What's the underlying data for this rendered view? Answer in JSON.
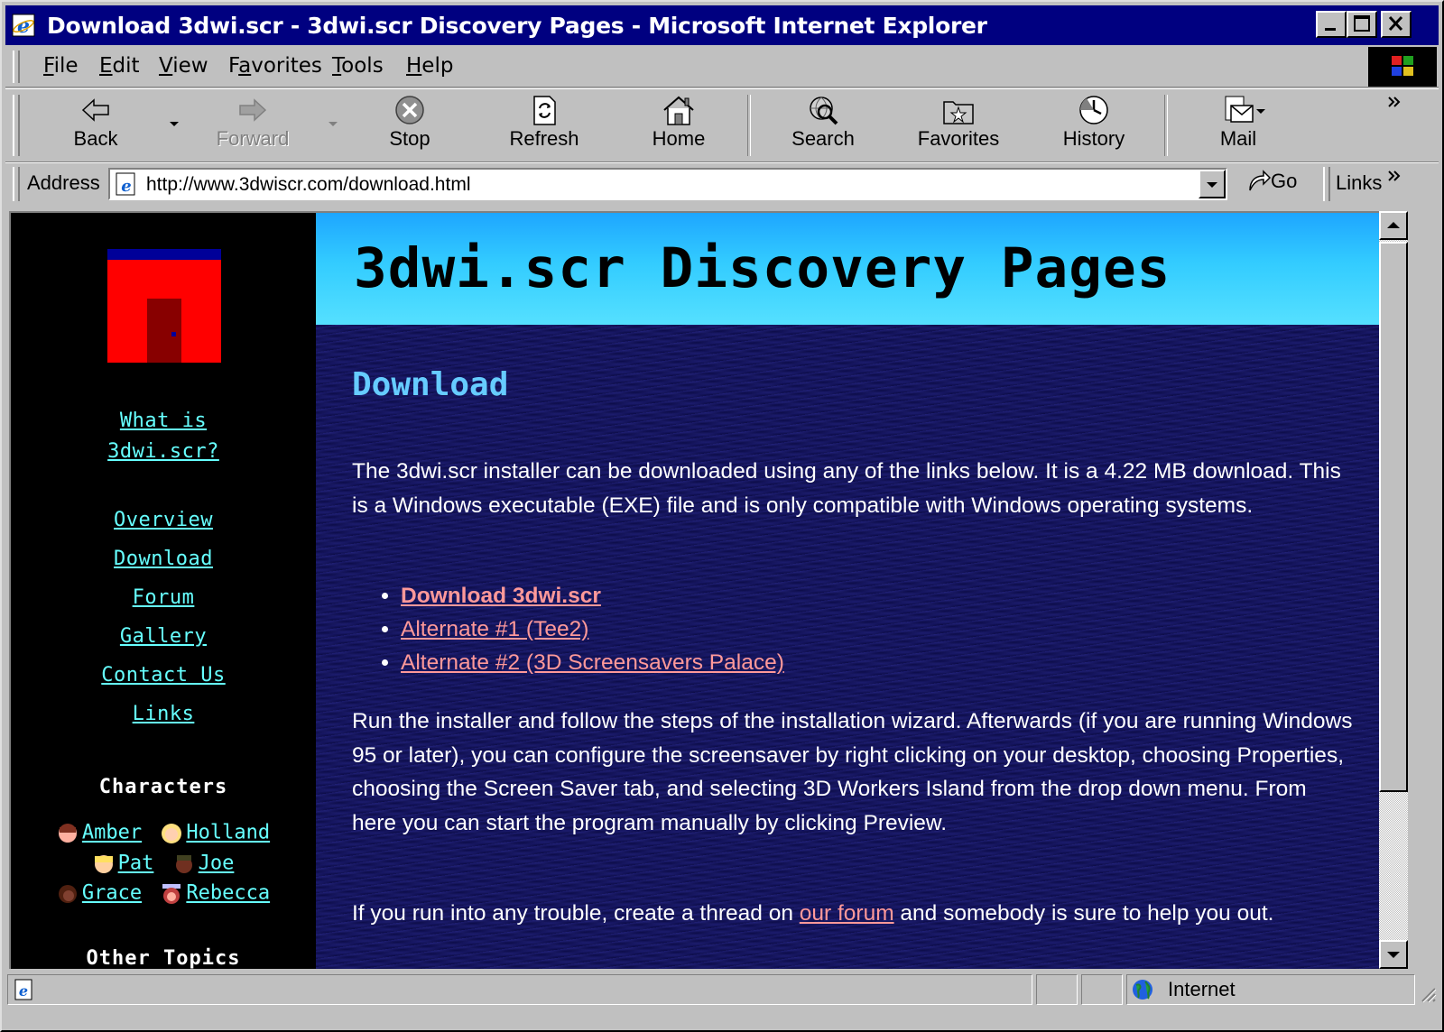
{
  "window": {
    "title": "Download 3dwi.scr - 3dwi.scr Discovery Pages - Microsoft Internet Explorer"
  },
  "menu": {
    "items": [
      {
        "label": "File",
        "accel": "F",
        "rest": "ile"
      },
      {
        "label": "Edit",
        "accel": "E",
        "rest": "dit"
      },
      {
        "label": "View",
        "accel": "V",
        "rest": "iew"
      },
      {
        "label": "Favorites",
        "pre": "F",
        "accel": "a",
        "rest": "vorites"
      },
      {
        "label": "Tools",
        "accel": "T",
        "rest": "ools"
      },
      {
        "label": "Help",
        "accel": "H",
        "rest": "elp"
      }
    ]
  },
  "toolbar": {
    "back": "Back",
    "forward": "Forward",
    "stop": "Stop",
    "refresh": "Refresh",
    "home": "Home",
    "search": "Search",
    "favorites": "Favorites",
    "history": "History",
    "mail": "Mail"
  },
  "address": {
    "label": "Address",
    "url": "http://www.3dwiscr.com/download.html",
    "go": "Go",
    "links": "Links"
  },
  "sidebar": {
    "what_is_1": "What is",
    "what_is_2": "3dwi.scr?",
    "nav": [
      "Overview",
      "Download",
      "Forum",
      "Gallery",
      "Contact Us",
      "Links"
    ],
    "characters_heading": "Characters",
    "characters": [
      "Amber",
      "Holland",
      "Pat",
      "Joe",
      "Grace",
      "Rebecca"
    ],
    "other_topics_heading": "Other Topics"
  },
  "page": {
    "banner_title": "3dwi.scr Discovery Pages",
    "heading": "Download",
    "intro": "The 3dwi.scr installer can be downloaded using any of the links below. It is a 4.22 MB download. This is a Windows executable (EXE) file and is only compatible with Windows operating systems.",
    "downloads": [
      "Download 3dwi.scr",
      "Alternate #1 (Tee2)",
      "Alternate #2 (3D Screensavers Palace)"
    ],
    "instructions": "Run the installer and follow the steps of the installation wizard. Afterwards (if you are running Windows 95 or later), you can configure the screensaver by right clicking on your desktop, choosing Properties, choosing the Screen Saver tab, and selecting 3D Workers Island from the drop down menu. From here you can start the program manually by clicking Preview.",
    "trouble_before": "If you run into any trouble, create a thread on ",
    "trouble_link": "our forum",
    "trouble_after": " and somebody is sure to help you out."
  },
  "status": {
    "zone": "Internet"
  },
  "colors": {
    "titlebar": "#000080",
    "chrome": "#c0c0c0",
    "banner": "#33ccff",
    "sidebar_link": "#66ffff",
    "content_link": "#ff9999",
    "heading": "#66ccff"
  }
}
